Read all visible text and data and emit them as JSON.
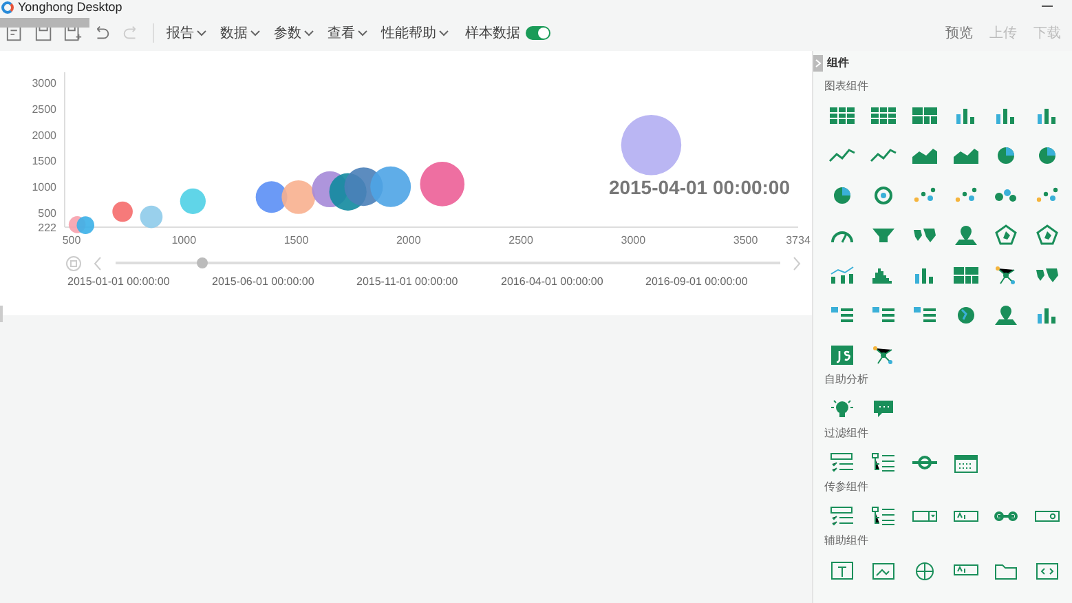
{
  "window": {
    "title": "Yonghong Desktop"
  },
  "toolbar": {
    "menus": [
      {
        "label": "报告"
      },
      {
        "label": "数据"
      },
      {
        "label": "参数"
      },
      {
        "label": "查看"
      },
      {
        "label": "性能帮助"
      }
    ],
    "sample_data": {
      "label": "样本数据",
      "on": true
    },
    "actions": [
      {
        "label": "预览",
        "disabled": false
      },
      {
        "label": "上传",
        "disabled": true
      },
      {
        "label": "下载",
        "disabled": true
      }
    ]
  },
  "chart": {
    "chart_data": {
      "type": "scatter",
      "xlim": [
        500,
        3734
      ],
      "ylim": [
        222,
        3200
      ],
      "xticks": [
        500,
        1000,
        1500,
        2000,
        2500,
        3000,
        3500,
        3734
      ],
      "yticks": [
        222,
        500,
        1000,
        1500,
        2000,
        2500,
        3000
      ],
      "series": [
        {
          "color": "#f7a1ad",
          "x": [
            525
          ],
          "values": [
            270
          ]
        },
        {
          "color": "#3bb0e8",
          "x": [
            562
          ],
          "values": [
            260
          ]
        },
        {
          "color": "#f56b6b",
          "x": [
            727
          ],
          "values": [
            520
          ]
        },
        {
          "color": "#8ecbea",
          "x": [
            855
          ],
          "values": [
            420
          ]
        },
        {
          "color": "#4fd0e6",
          "x": [
            1040
          ],
          "values": [
            720
          ]
        },
        {
          "color": "#5b8ff5",
          "x": [
            1390
          ],
          "values": [
            800
          ]
        },
        {
          "color": "#f8b08f",
          "x": [
            1510
          ],
          "values": [
            800
          ]
        },
        {
          "color": "#a58ad8",
          "x": [
            1650
          ],
          "values": [
            950
          ]
        },
        {
          "color": "#12899f",
          "x": [
            1730
          ],
          "values": [
            900
          ]
        },
        {
          "color": "#4a7fb8",
          "x": [
            1800
          ],
          "values": [
            1000
          ]
        },
        {
          "color": "#4ea4e6",
          "x": [
            1920
          ],
          "values": [
            1000
          ]
        },
        {
          "color": "#ec5f97",
          "x": [
            2150
          ],
          "values": [
            1050
          ]
        },
        {
          "color": "#b3aef2",
          "x": [
            3080
          ],
          "values": [
            1800
          ]
        }
      ],
      "annotations": [
        "2015-04-01 00:00:00"
      ]
    },
    "timeline": {
      "level": 0.13,
      "labels": [
        "2015-01-01 00:00:00",
        "2015-06-01 00:00:00",
        "2015-11-01 00:00:00",
        "2016-04-01 00:00:00",
        "2016-09-01 00:00:00"
      ]
    }
  },
  "component_panel": {
    "title": "组件",
    "sections": [
      {
        "title": "图表组件"
      },
      {
        "title": "自助分析"
      },
      {
        "title": "过滤组件"
      },
      {
        "title": "传参组件"
      },
      {
        "title": "辅助组件"
      }
    ]
  }
}
